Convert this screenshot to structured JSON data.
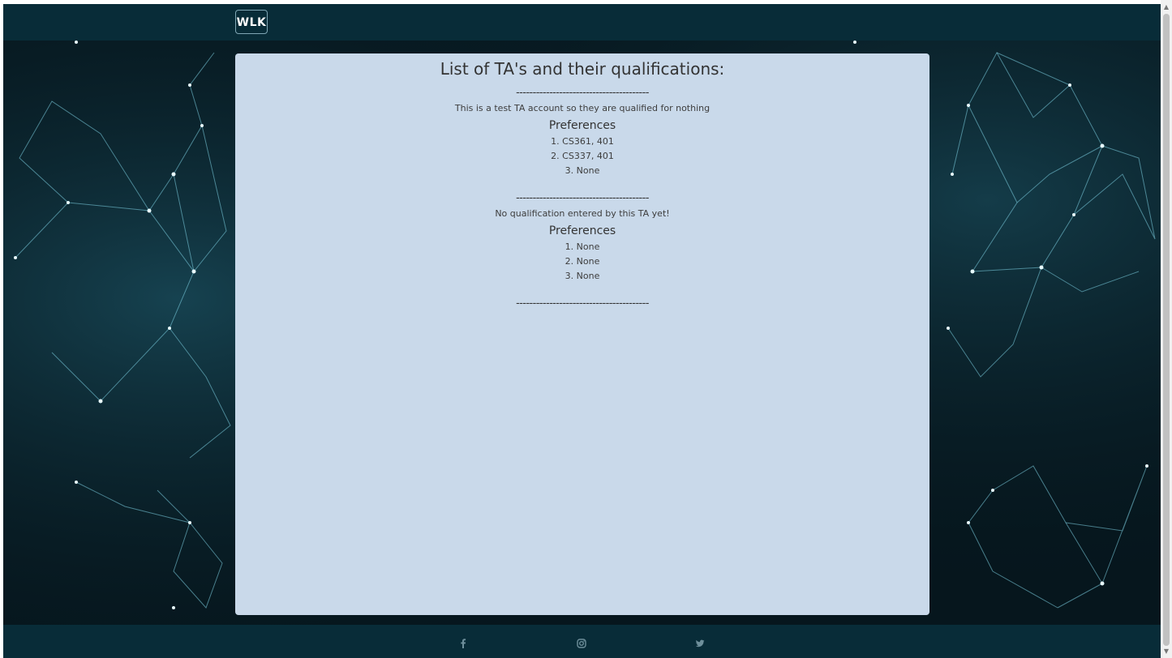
{
  "navbar": {
    "brand": "WLK"
  },
  "main": {
    "title": "List of TA's and their qualifications:",
    "separator": "----------------------------------------",
    "entries": [
      {
        "qualification": "This is a test TA account so they are qualified for nothing",
        "preferences_heading": "Preferences",
        "preferences": [
          "1. CS361, 401",
          "2. CS337, 401",
          "3. None"
        ]
      },
      {
        "qualification": "No qualification entered by this TA yet!",
        "preferences_heading": "Preferences",
        "preferences": [
          "1. None",
          "2. None",
          "3. None"
        ]
      }
    ]
  },
  "footer": {
    "icons": [
      "facebook-icon",
      "instagram-icon",
      "twitter-icon"
    ]
  },
  "colors": {
    "navbar": "#082c38",
    "card": "#c9d9ea",
    "background": "#071a22",
    "network_lines": "#7fd3e6"
  }
}
